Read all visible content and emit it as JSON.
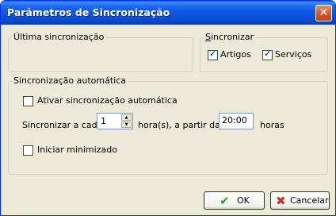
{
  "window": {
    "title": "Parâmetros de Sincronização",
    "close_glyph": "✕"
  },
  "last_sync": {
    "legend": "Última sincronização"
  },
  "sync": {
    "legend": "Sincronizar",
    "artigos": {
      "label": "Artigos",
      "checked": true
    },
    "servicos": {
      "label": "Serviços",
      "checked": true
    }
  },
  "auto_sync": {
    "legend": "Sincronização automática",
    "enable": {
      "label": "Ativar sincronização automática",
      "checked": false
    },
    "interval_label": "Sincronizar a cada",
    "interval_value": "1",
    "interval_unit": "hora(s), a partir das",
    "start_time": "20:00",
    "start_unit": "horas",
    "minimized": {
      "label": "Iniciar minimizado",
      "checked": false
    }
  },
  "buttons": {
    "ok": {
      "label": "OK",
      "icon": "check-icon"
    },
    "cancel": {
      "label": "Cancelar",
      "icon": "x-icon"
    }
  },
  "colors": {
    "title_bar": "#0a4fd8",
    "ok_icon": "#2b9e2b",
    "cancel_icon": "#c8302a"
  }
}
